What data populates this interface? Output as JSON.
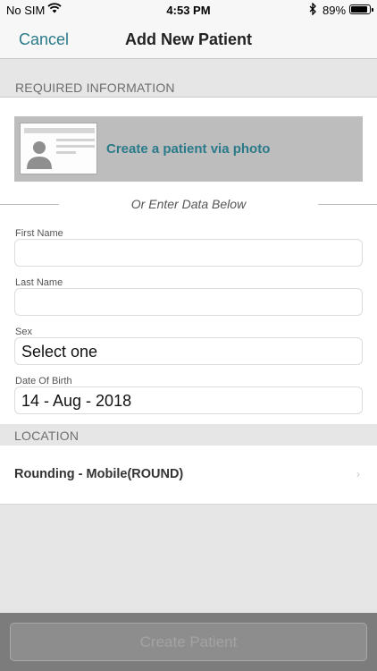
{
  "status_bar": {
    "carrier": "No SIM",
    "time": "4:53 PM",
    "battery_percent": "89%"
  },
  "nav": {
    "cancel_label": "Cancel",
    "title": "Add New Patient"
  },
  "sections": {
    "required": "REQUIRED INFORMATION",
    "location": "LOCATION"
  },
  "photo_option": {
    "label": "Create a patient via photo"
  },
  "divider_text": "Or Enter Data Below",
  "fields": {
    "first_name": {
      "label": "First Name",
      "value": ""
    },
    "last_name": {
      "label": "Last Name",
      "value": ""
    },
    "sex": {
      "label": "Sex",
      "value": "Select one"
    },
    "dob": {
      "label": "Date Of Birth",
      "value": "14 - Aug - 2018"
    }
  },
  "location": {
    "value": "Rounding - Mobile(ROUND)",
    "chevron": "›"
  },
  "footer": {
    "create_label": "Create Patient"
  },
  "icons": {
    "wifi": "wifi-icon",
    "bluetooth": "bluetooth-icon",
    "battery": "battery-icon",
    "id_card": "id-card-icon",
    "chevron": "chevron-right-icon"
  }
}
